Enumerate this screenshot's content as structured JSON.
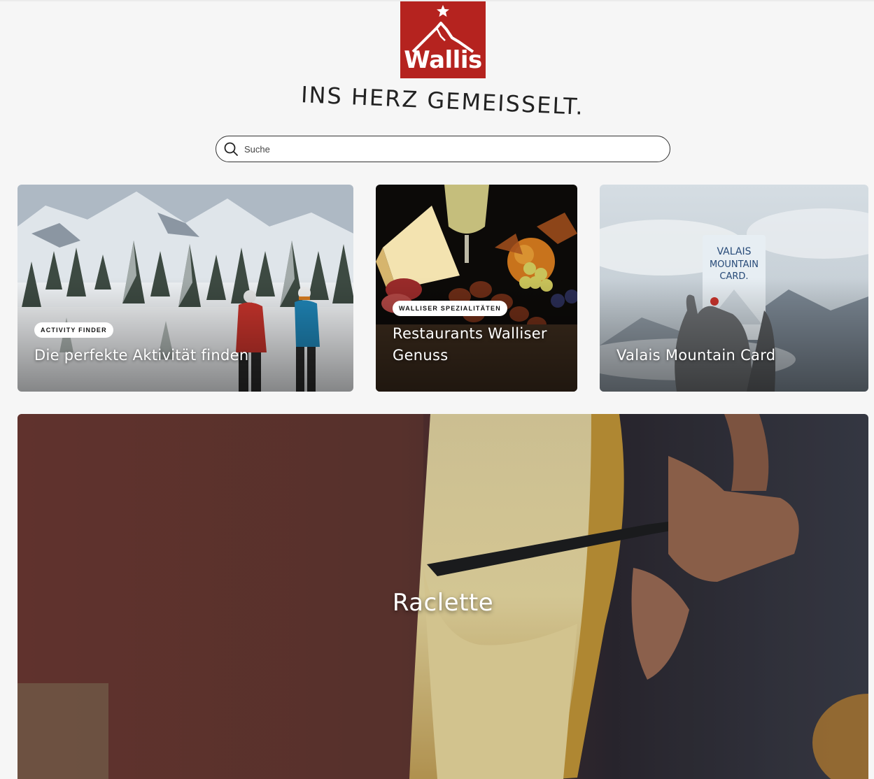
{
  "brand": {
    "logo_text": "Wallis",
    "slogan": "INS HERZ GEMEISSELT.",
    "logo_color": "#b5231f"
  },
  "search": {
    "placeholder": "Suche",
    "icon": "search-icon"
  },
  "cards": [
    {
      "tag": "ACTIVITY FINDER",
      "title": "Die perfekte Aktivität finden"
    },
    {
      "tag": "WALLISER SPEZIALITÄTEN",
      "title": "Restaurants Walliser Genuss"
    },
    {
      "title": "Valais Mountain Card",
      "card_text": "VALAIS MOUNTAIN CARD."
    }
  ],
  "hero": {
    "title": "Raclette"
  }
}
